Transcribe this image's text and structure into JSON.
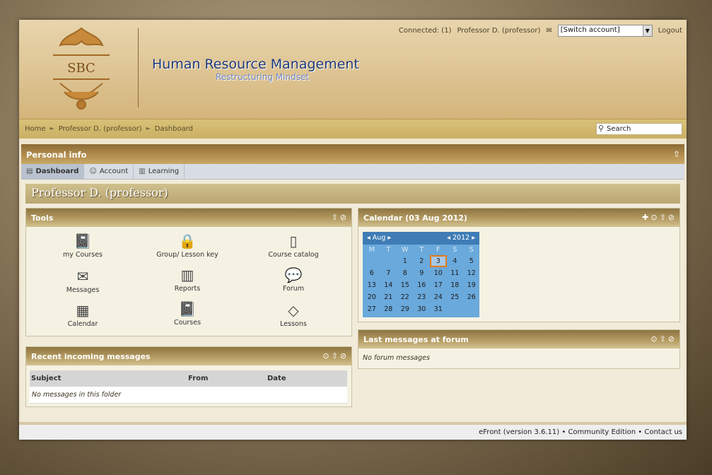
{
  "header": {
    "logo_text": "SBC",
    "title": "Human Resource Management",
    "subtitle": "Restructuring Mindset",
    "connected_label": "Connected: (1)",
    "user": "Professor D. (professor)",
    "switch_account": "[Switch account]",
    "logout": "Logout"
  },
  "breadcrumb": [
    "Home",
    "Professor D. (professor)",
    "Dashboard"
  ],
  "search": {
    "label": "Search"
  },
  "panel": {
    "title": "Personal info"
  },
  "tabs": [
    {
      "label": "Dashboard",
      "icon": "dashboard-icon"
    },
    {
      "label": "Account",
      "icon": "user-icon"
    },
    {
      "label": "Learning",
      "icon": "book-icon"
    }
  ],
  "profile_name": "Professor D. (professor)",
  "tools": {
    "title": "Tools",
    "items": [
      {
        "label": "my Courses",
        "icon": "courses-icon"
      },
      {
        "label": "Group/ Lesson key",
        "icon": "lock-icon"
      },
      {
        "label": "Course catalog",
        "icon": "catalog-icon"
      },
      {
        "label": "Messages",
        "icon": "messages-icon"
      },
      {
        "label": "Reports",
        "icon": "reports-icon"
      },
      {
        "label": "Forum",
        "icon": "forum-icon"
      },
      {
        "label": "Calendar",
        "icon": "calendar-icon"
      },
      {
        "label": "Courses",
        "icon": "courses-icon"
      },
      {
        "label": "Lessons",
        "icon": "lessons-icon"
      }
    ]
  },
  "calendar": {
    "title": "Calendar (03 Aug 2012)",
    "month": "Aug",
    "year": "2012",
    "weekdays": [
      "M",
      "T",
      "W",
      "T",
      "F",
      "S",
      "S"
    ],
    "days": [
      "",
      "",
      "1",
      "2",
      "3",
      "4",
      "5",
      "6",
      "7",
      "8",
      "9",
      "10",
      "11",
      "12",
      "13",
      "14",
      "15",
      "16",
      "17",
      "18",
      "19",
      "20",
      "21",
      "22",
      "23",
      "24",
      "25",
      "26",
      "27",
      "28",
      "29",
      "30",
      "31",
      "",
      ""
    ],
    "today": "3"
  },
  "messages": {
    "title": "Recent incoming messages",
    "columns": [
      "Subject",
      "From",
      "Date"
    ],
    "empty": "No messages in this folder"
  },
  "forum": {
    "title": "Last messages at forum",
    "empty": "No forum messages"
  },
  "footer": {
    "version": "eFront (version 3.6.11)",
    "edition": "Community Edition",
    "contact": "Contact us"
  }
}
